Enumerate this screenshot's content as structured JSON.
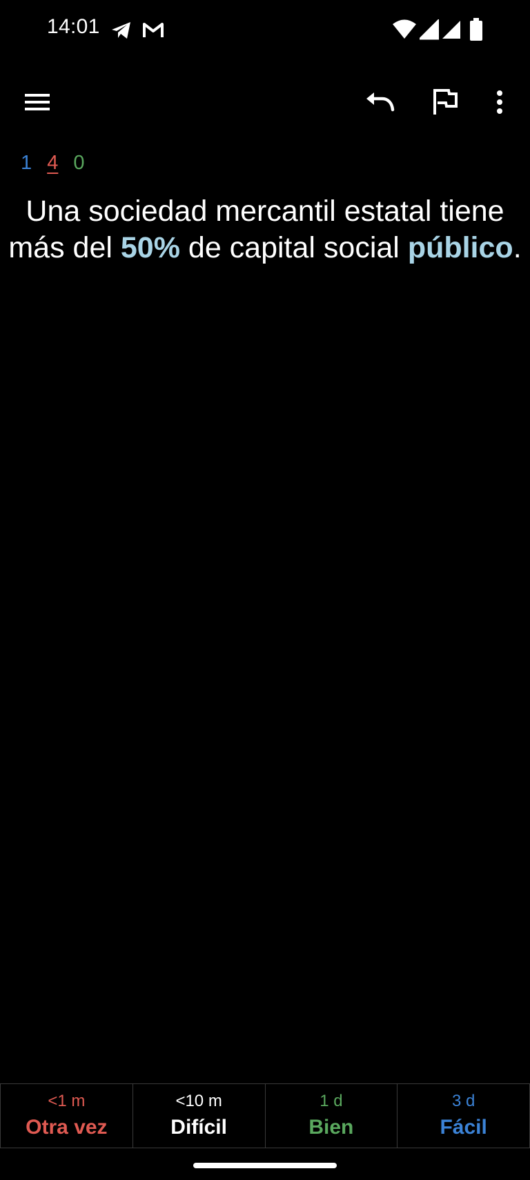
{
  "status_bar": {
    "time": "14:01",
    "icons": [
      "telegram-icon",
      "gmail-icon",
      "wifi-icon",
      "signal-icon",
      "signal-icon",
      "battery-icon"
    ]
  },
  "toolbar": {
    "icons": [
      "menu-icon",
      "undo-icon",
      "flag-icon",
      "more-vert-icon"
    ]
  },
  "counts": {
    "new": "1",
    "learning": "4",
    "review": "0"
  },
  "card": {
    "line_parts": [
      {
        "text": "Una sociedad mercantil estatal tiene más del ",
        "highlight": false
      },
      {
        "text": "50%",
        "highlight": true
      },
      {
        "text": " de capital social ",
        "highlight": false
      },
      {
        "text": "público",
        "highlight": true
      },
      {
        "text": ".",
        "highlight": false
      }
    ],
    "text_1": "Una sociedad mercantil estatal tiene más del ",
    "highlight_1": "50%",
    "text_2": " de capital social ",
    "highlight_2": "público",
    "text_3": "."
  },
  "answers": [
    {
      "time": "<1 m",
      "label": "Otra vez",
      "color": "#e05a52"
    },
    {
      "time": "<10 m",
      "label": "Difícil",
      "color": "#ffffff"
    },
    {
      "time": "1 d",
      "label": "Bien",
      "color": "#5aa85e"
    },
    {
      "time": "3 d",
      "label": "Fácil",
      "color": "#3b82d6"
    }
  ],
  "colors": {
    "background": "#000000",
    "highlight": "#a9d4e6",
    "new": "#3b82d6",
    "learning": "#e05a52",
    "review": "#5aa85e"
  }
}
